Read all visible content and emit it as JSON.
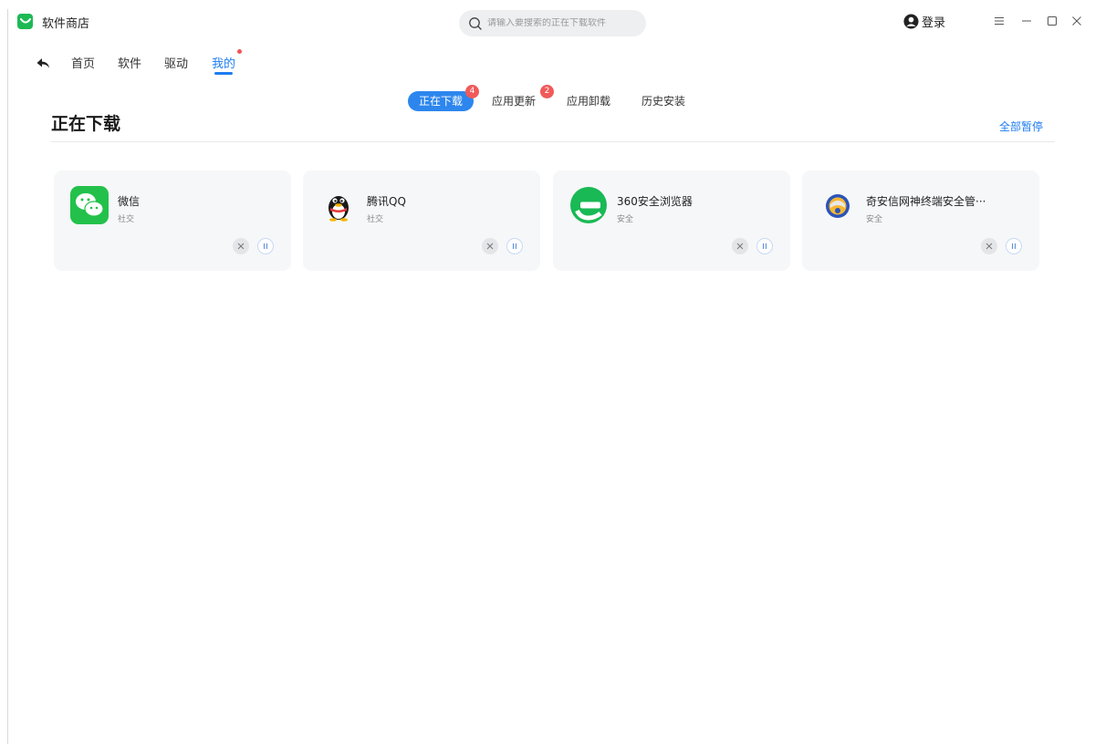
{
  "titlebar": {
    "app_title": "软件商店",
    "search_placeholder": "请输入要搜索的正在下载软件",
    "login_label": "登录"
  },
  "nav": {
    "items": [
      {
        "label": "首页"
      },
      {
        "label": "软件"
      },
      {
        "label": "驱动"
      },
      {
        "label": "我的",
        "active": true
      }
    ]
  },
  "subtabs": [
    {
      "label": "正在下载",
      "badge": "4",
      "active": true
    },
    {
      "label": "应用更新",
      "badge": "2"
    },
    {
      "label": "应用卸载"
    },
    {
      "label": "历史安装"
    }
  ],
  "section": {
    "title": "正在下载",
    "pause_all_label": "全部暂停"
  },
  "downloads": [
    {
      "name": "微信",
      "category": "社交",
      "icon": "wechat-icon"
    },
    {
      "name": "腾讯QQ",
      "category": "社交",
      "icon": "qq-penguin-icon"
    },
    {
      "name": "360安全浏览器",
      "category": "安全",
      "icon": "360-browser-icon"
    },
    {
      "name": "奇安信网神终端安全管···",
      "category": "安全",
      "icon": "qianxin-icon"
    }
  ],
  "colors": {
    "accent": "#1e7cf0",
    "badge": "#f05a5a",
    "card_bg": "#f6f7f9"
  }
}
